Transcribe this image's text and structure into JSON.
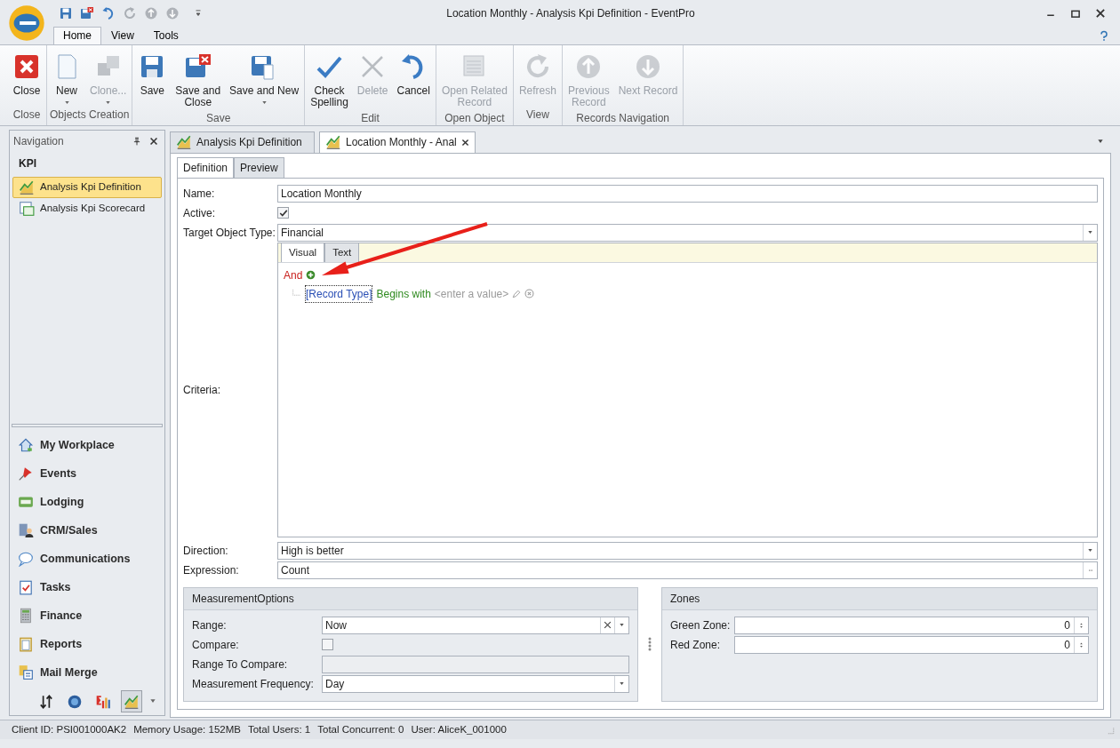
{
  "window": {
    "title": "Location Monthly - Analysis Kpi Definition - EventPro"
  },
  "ribbon_tabs": [
    {
      "label": "Home",
      "selected": true
    },
    {
      "label": "View",
      "selected": false
    },
    {
      "label": "Tools",
      "selected": false
    }
  ],
  "ribbon_groups": [
    {
      "label": "Close",
      "buttons": [
        {
          "label": "Close",
          "kind": "close",
          "disabled": false,
          "dropdown": false
        }
      ]
    },
    {
      "label": "Objects Creation",
      "buttons": [
        {
          "label": "New",
          "kind": "new",
          "disabled": false,
          "dropdown": true
        },
        {
          "label": "Clone...",
          "kind": "clone",
          "disabled": true,
          "dropdown": true
        }
      ]
    },
    {
      "label": "Save",
      "buttons": [
        {
          "label": "Save",
          "kind": "save",
          "disabled": false,
          "dropdown": false
        },
        {
          "label": "Save and Close",
          "kind": "saveclose",
          "disabled": false,
          "dropdown": false
        },
        {
          "label": "Save and New",
          "kind": "savenew",
          "disabled": false,
          "dropdown": true
        }
      ]
    },
    {
      "label": "Edit",
      "buttons": [
        {
          "label": "Check Spelling",
          "kind": "spell",
          "disabled": false,
          "dropdown": false
        },
        {
          "label": "Delete",
          "kind": "delete",
          "disabled": true,
          "dropdown": false
        },
        {
          "label": "Cancel",
          "kind": "undo",
          "disabled": false,
          "dropdown": false
        }
      ]
    },
    {
      "label": "Open Object",
      "buttons": [
        {
          "label": "Open Related Record",
          "kind": "related",
          "disabled": true,
          "dropdown": false
        }
      ]
    },
    {
      "label": "View",
      "buttons": [
        {
          "label": "Refresh",
          "kind": "refresh",
          "disabled": true,
          "dropdown": false
        }
      ]
    },
    {
      "label": "Records Navigation",
      "buttons": [
        {
          "label": "Previous Record",
          "kind": "up",
          "disabled": true,
          "dropdown": false
        },
        {
          "label": "Next Record",
          "kind": "down",
          "disabled": true,
          "dropdown": false
        }
      ]
    }
  ],
  "navigation": {
    "title": "Navigation",
    "section": "KPI",
    "items": [
      {
        "label": "Analysis Kpi Definition",
        "kind": "kpi",
        "selected": true
      },
      {
        "label": "Analysis Kpi Scorecard",
        "kind": "scorecard",
        "selected": false
      }
    ],
    "modules": [
      {
        "label": "My Workplace",
        "kind": "home"
      },
      {
        "label": "Events",
        "kind": "pin"
      },
      {
        "label": "Lodging",
        "kind": "bed"
      },
      {
        "label": "CRM/Sales",
        "kind": "crm"
      },
      {
        "label": "Communications",
        "kind": "bubble"
      },
      {
        "label": "Tasks",
        "kind": "tasks"
      },
      {
        "label": "Finance",
        "kind": "calc"
      },
      {
        "label": "Reports",
        "kind": "report"
      },
      {
        "label": "Mail Merge",
        "kind": "merge"
      }
    ],
    "shortcuts": [
      {
        "kind": "sort",
        "selected": false
      },
      {
        "kind": "globe",
        "selected": false
      },
      {
        "kind": "bars",
        "selected": false
      },
      {
        "kind": "kpi",
        "selected": true
      }
    ]
  },
  "document_tabs": [
    {
      "label": "Analysis Kpi Definition",
      "selected": false,
      "closable": false
    },
    {
      "label": "Location Monthly - Anal",
      "selected": true,
      "closable": true
    }
  ],
  "form": {
    "tabs": [
      {
        "label": "Definition",
        "selected": true
      },
      {
        "label": "Preview",
        "selected": false
      }
    ],
    "name": {
      "label": "Name:",
      "value": "Location Monthly"
    },
    "active": {
      "label": "Active:",
      "checked": true
    },
    "target_object_type": {
      "label": "Target Object Type:",
      "value": "Financial"
    },
    "criteria": {
      "label": "Criteria:",
      "tabs": [
        {
          "label": "Visual",
          "selected": true
        },
        {
          "label": "Text",
          "selected": false
        }
      ],
      "group": "And",
      "condition": {
        "field": "[Record Type]",
        "operator": "Begins with",
        "value": "<enter a value>"
      }
    },
    "direction": {
      "label": "Direction:",
      "value": "High is better"
    },
    "expression": {
      "label": "Expression:",
      "value": "Count"
    },
    "measurement_options": {
      "title": "MeasurementOptions",
      "range": {
        "label": "Range:",
        "value": "Now"
      },
      "compare": {
        "label": "Compare:",
        "checked": false
      },
      "range_to_compare": {
        "label": "Range To Compare:"
      },
      "frequency": {
        "label": "Measurement Frequency:",
        "value": "Day"
      }
    },
    "zones": {
      "title": "Zones",
      "items": [
        {
          "label": "Green Zone:",
          "value": "0"
        },
        {
          "label": "Red Zone:",
          "value": "0"
        }
      ]
    }
  },
  "status_bar": [
    "Client ID: PSI001000AK2",
    "Memory Usage: 152MB",
    "Total Users: 1",
    "Total Concurrent: 0",
    "User: AliceK_001000"
  ]
}
